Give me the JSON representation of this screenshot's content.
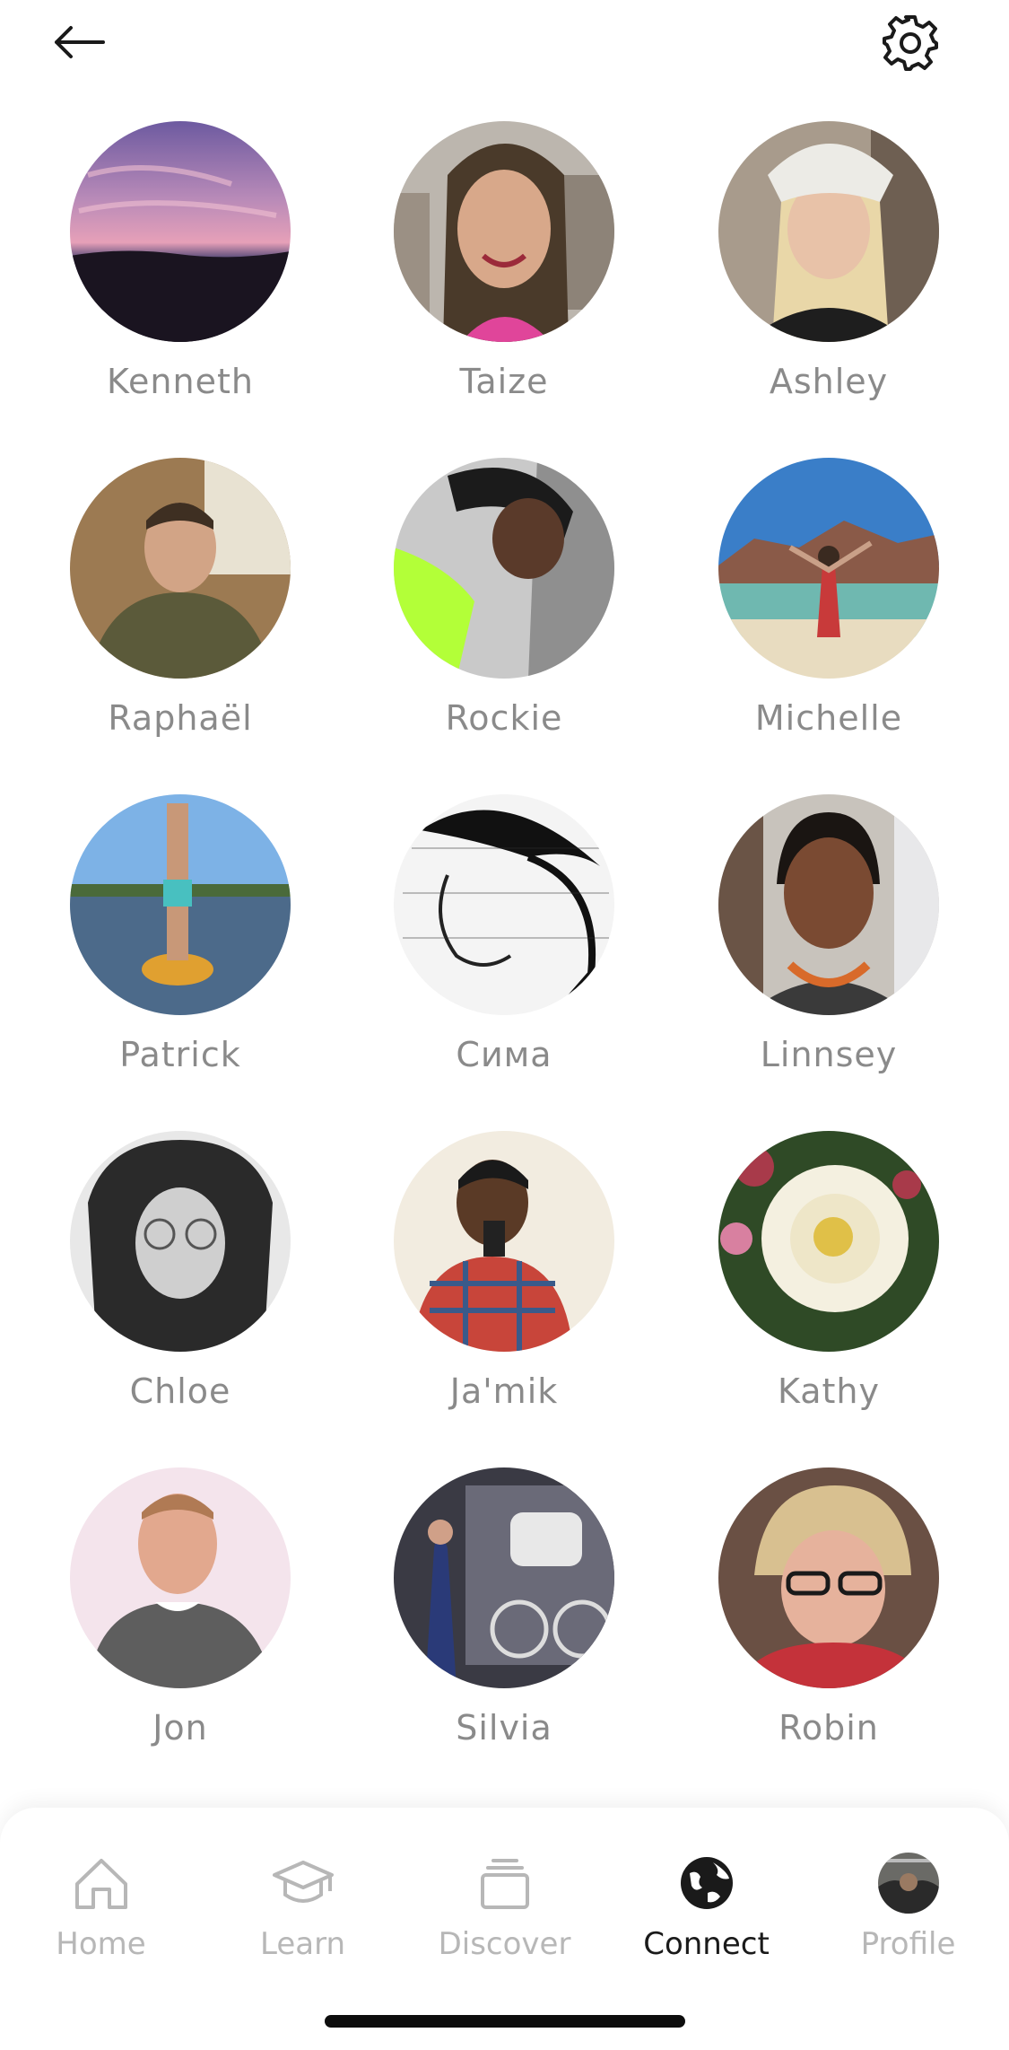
{
  "header": {
    "back_icon": "arrow-left-icon",
    "settings_icon": "gear-icon"
  },
  "people": [
    {
      "name": "Kenneth"
    },
    {
      "name": "Taize"
    },
    {
      "name": "Ashley"
    },
    {
      "name": "Raphaël"
    },
    {
      "name": "Rockie"
    },
    {
      "name": "Michelle"
    },
    {
      "name": "Patrick"
    },
    {
      "name": "Сима"
    },
    {
      "name": "Linnsey"
    },
    {
      "name": "Chloe"
    },
    {
      "name": "Ja'mik"
    },
    {
      "name": "Kathy"
    },
    {
      "name": "Jon"
    },
    {
      "name": "Silvia"
    },
    {
      "name": "Robin"
    }
  ],
  "tabs": [
    {
      "label": "Home",
      "icon": "home-icon",
      "active": false
    },
    {
      "label": "Learn",
      "icon": "graduation-cap-icon",
      "active": false
    },
    {
      "label": "Discover",
      "icon": "stack-icon",
      "active": false
    },
    {
      "label": "Connect",
      "icon": "globe-icon",
      "active": true
    },
    {
      "label": "Profile",
      "icon": "profile-avatar-icon",
      "active": false
    }
  ],
  "colors": {
    "name_text": "#8a8a8a",
    "tab_inactive": "#b7b7b7",
    "tab_active": "#1a1a1a",
    "background": "#ffffff"
  }
}
